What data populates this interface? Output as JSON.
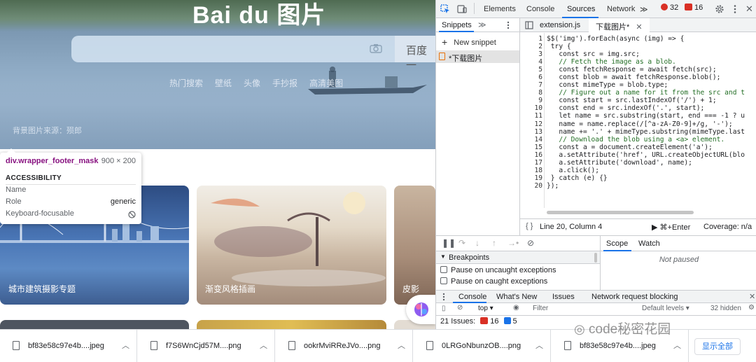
{
  "baidu": {
    "logo": "Bai du 图片",
    "search_button": "百度一",
    "hot_links": [
      "热门搜索",
      "壁纸",
      "头像",
      "手抄报",
      "高清美图"
    ],
    "image_source": "背景图片来源：殒郎",
    "cards": [
      {
        "label": "城市建筑摄影专题"
      },
      {
        "label": "渐变风格插画"
      },
      {
        "label": "皮影"
      }
    ]
  },
  "tooltip": {
    "selector": "div.wrapper_footer_mask",
    "size": "900 × 200",
    "heading": "ACCESSIBILITY",
    "name_label": "Name",
    "role_label": "Role",
    "role_value": "generic",
    "keyboard_label": "Keyboard-focusable"
  },
  "devtools": {
    "tabs": [
      "Elements",
      "Console",
      "Sources",
      "Network"
    ],
    "active_tab": "Sources",
    "more_tabs": "≫",
    "errors": "32",
    "warnings": "16",
    "navigator": {
      "tab": "Snippets",
      "more": "≫",
      "new_snippet": "New snippet",
      "snippet_item": "*下载图片"
    },
    "editor": {
      "tabs": [
        "extension.js",
        "下载图片*"
      ],
      "line_numbers": [
        "1",
        "2",
        "3",
        "4",
        "5",
        "6",
        "7",
        "8",
        "9",
        "10",
        "11",
        "12",
        "13",
        "14",
        "15",
        "16",
        "17",
        "18",
        "19",
        "20"
      ],
      "code_lines": [
        "$$('img').forEach(async (img) => {",
        " try {",
        "   const src = img.src;",
        "   // Fetch the image as a blob.",
        "   const fetchResponse = await fetch(src);",
        "   const blob = await fetchResponse.blob();",
        "   const mimeType = blob.type;",
        "   // Figure out a name for it from the src and t",
        "   const start = src.lastIndexOf('/') + 1;",
        "   const end = src.indexOf('.', start);",
        "   let name = src.substring(start, end === -1 ? u",
        "   name = name.replace(/[^a-zA-Z0-9]+/g, '-');",
        "   name += '.' + mimeType.substring(mimeType.last",
        "   // Download the blob using a <a> element.",
        "   const a = document.createElement('a');",
        "   a.setAttribute('href', URL.createObjectURL(blo",
        "   a.setAttribute('download', name);",
        "   a.click();",
        " } catch (e) {}",
        "});"
      ]
    },
    "status": {
      "braces": "{ }",
      "position": "Line 20, Column 4",
      "run": "▶ ⌘+Enter",
      "coverage": "Coverage: n/a"
    },
    "debugger": {
      "breakpoints_heading": "Breakpoints",
      "pause_uncaught": "Pause on uncaught exceptions",
      "pause_caught": "Pause on caught exceptions",
      "scope_tab": "Scope",
      "watch_tab": "Watch",
      "not_paused": "Not paused"
    },
    "drawer": {
      "tabs": [
        "Console",
        "What's New",
        "Issues",
        "Network request blocking"
      ],
      "context": "top ▾",
      "filter_placeholder": "Filter",
      "levels": "Default levels ▾",
      "hidden": "32 hidden",
      "issues_text": "21 Issues:",
      "issues_errors": "16",
      "issues_info": "5"
    }
  },
  "downloads": {
    "items": [
      {
        "name": "bf83e58c97e4b....jpeg"
      },
      {
        "name": "f7S6WnCjd57M....png"
      },
      {
        "name": "ookrMviRReJVo....png"
      },
      {
        "name": "0LRGoNbunzOB....png"
      },
      {
        "name": "bf83e58c97e4b....jpeg"
      }
    ],
    "show_all": "显示全部"
  },
  "watermark": "code秘密花园",
  "colors": {
    "accent": "#1a73e8",
    "error": "#d93025",
    "selector": "#881280"
  }
}
